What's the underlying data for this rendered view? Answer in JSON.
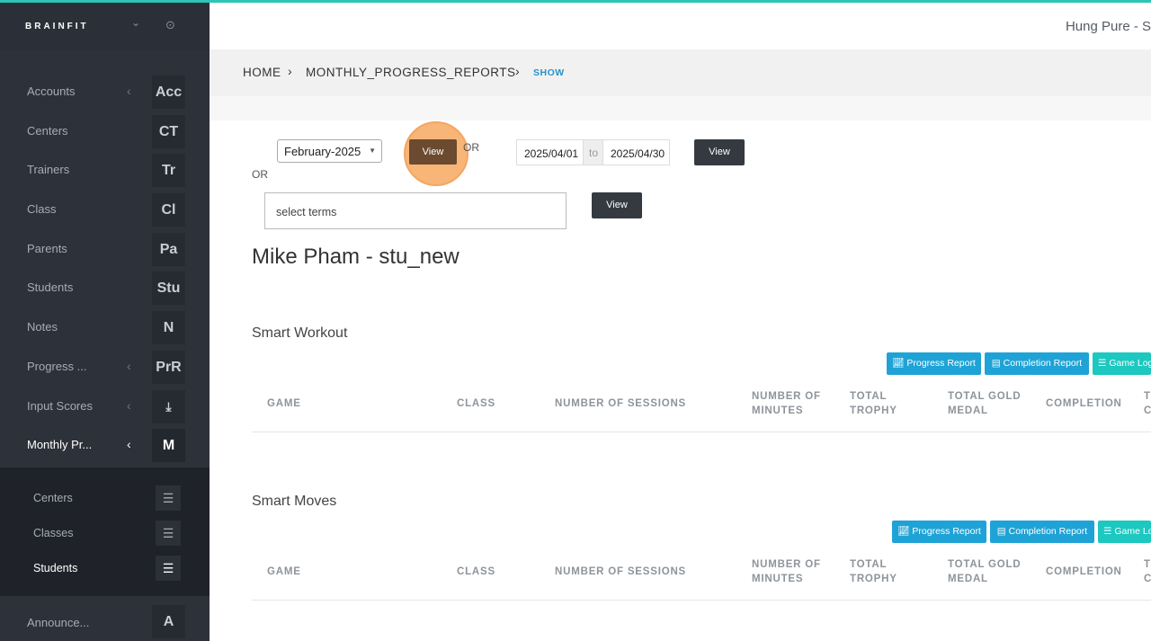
{
  "app": {
    "brand": "BRAINFIT",
    "user_name": "Hung Pure - S"
  },
  "colors": {
    "accent": "#2ec4b6",
    "sidebar": "#2d3139",
    "link": "#2693c7",
    "report_blue": "#1fa3d6",
    "report_teal": "#1cc8c0"
  },
  "sidebar": {
    "items": [
      {
        "label": "Accounts",
        "abbr": "Acc",
        "has_chevron": true
      },
      {
        "label": "Centers",
        "abbr": "CT",
        "has_chevron": false
      },
      {
        "label": "Trainers",
        "abbr": "Tr",
        "has_chevron": false
      },
      {
        "label": "Class",
        "abbr": "Cl",
        "has_chevron": false
      },
      {
        "label": "Parents",
        "abbr": "Pa",
        "has_chevron": false
      },
      {
        "label": "Students",
        "abbr": "Stu",
        "has_chevron": false
      },
      {
        "label": "Notes",
        "abbr": "N",
        "has_chevron": false
      },
      {
        "label": "Progress ...",
        "abbr": "PrR",
        "has_chevron": true
      },
      {
        "label": "Input Scores",
        "abbr": "download-icon",
        "has_chevron": true
      },
      {
        "label": "Monthly Pr...",
        "abbr": "M",
        "has_chevron": true
      }
    ],
    "subitems": [
      {
        "label": "Centers"
      },
      {
        "label": "Classes"
      },
      {
        "label": "Students"
      }
    ],
    "announce": {
      "label": "Announce...",
      "abbr": "A"
    }
  },
  "breadcrumb": {
    "home": "HOME",
    "section": "MONTHLY_PROGRESS_REPORTS",
    "current": "SHOW"
  },
  "filters": {
    "month_value": "February-2025",
    "view_label": "View",
    "or_label": "OR",
    "date_from": "2025/04/01",
    "date_to_label": "to",
    "date_to": "2025/04/30",
    "terms_placeholder": "select terms"
  },
  "student": {
    "title": "Mike Pham - stu_new"
  },
  "report_buttons": {
    "progress": "Progress Report",
    "completion": "Completion Report",
    "game_log": "Game Log"
  },
  "table_headers": [
    "GAME",
    "CLASS",
    "NUMBER OF SESSIONS",
    "NUMBER OF MINUTES",
    "TOTAL TROPHY",
    "TOTAL GOLD MEDAL",
    "COMPLETION",
    "T C"
  ],
  "sections": [
    {
      "title": "Smart Workout"
    },
    {
      "title": "Smart Moves"
    }
  ]
}
